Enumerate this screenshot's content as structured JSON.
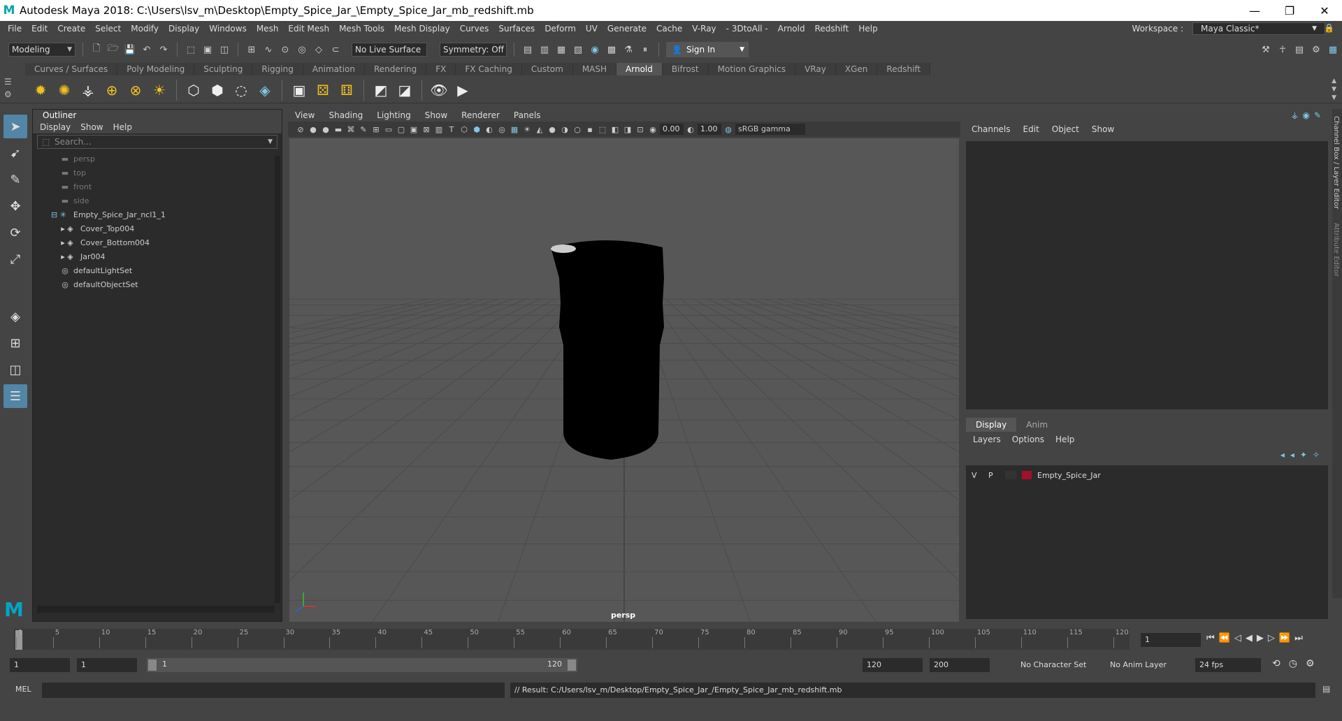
{
  "window": {
    "title": "Autodesk Maya 2018: C:\\Users\\lsv_m\\Desktop\\Empty_Spice_Jar_\\Empty_Spice_Jar_mb_redshift.mb"
  },
  "menus": [
    "File",
    "Edit",
    "Create",
    "Select",
    "Modify",
    "Display",
    "Windows",
    "Mesh",
    "Edit Mesh",
    "Mesh Tools",
    "Mesh Display",
    "Curves",
    "Surfaces",
    "Deform",
    "UV",
    "Generate",
    "Cache",
    "V-Ray",
    "- 3DtoAll -",
    "Arnold",
    "Redshift",
    "Help"
  ],
  "workspace": {
    "label": "Workspace :",
    "value": "Maya Classic*"
  },
  "status": {
    "mode": "Modeling",
    "live_surface": "No Live Surface",
    "symmetry": "Symmetry: Off",
    "sign_in": "Sign In"
  },
  "shelf_tabs": [
    "Curves / Surfaces",
    "Poly Modeling",
    "Sculpting",
    "Rigging",
    "Animation",
    "Rendering",
    "FX",
    "FX Caching",
    "Custom",
    "MASH",
    "Arnold",
    "Bifrost",
    "Motion Graphics",
    "VRay",
    "XGen",
    "Redshift"
  ],
  "active_shelf": "Arnold",
  "outliner": {
    "title": "Outliner",
    "menu": [
      "Display",
      "Show",
      "Help"
    ],
    "search_placeholder": "Search...",
    "cameras": [
      "persp",
      "top",
      "front",
      "side"
    ],
    "group": "Empty_Spice_Jar_ncl1_1",
    "children": [
      "Cover_Top004",
      "Cover_Bottom004",
      "Jar004"
    ],
    "sets": [
      "defaultLightSet",
      "defaultObjectSet"
    ]
  },
  "viewport": {
    "menu": [
      "View",
      "Shading",
      "Lighting",
      "Show",
      "Renderer",
      "Panels"
    ],
    "exposure": "0.00",
    "gamma": "1.00",
    "color_space": "sRGB gamma",
    "camera_label": "persp"
  },
  "channel_box": {
    "menu": [
      "Channels",
      "Edit",
      "Object",
      "Show"
    ],
    "side_label": "Channel Box / Layer Editor",
    "side_label2": "Attribute Editor"
  },
  "layer_editor": {
    "tabs": [
      "Display",
      "Anim"
    ],
    "menu": [
      "Layers",
      "Options",
      "Help"
    ],
    "layer": {
      "v": "V",
      "p": "P",
      "name": "Empty_Spice_Jar",
      "color": "#a3102a"
    }
  },
  "timeline": {
    "ticks": [
      "1",
      "5",
      "10",
      "15",
      "20",
      "25",
      "30",
      "35",
      "40",
      "45",
      "50",
      "55",
      "60",
      "65",
      "70",
      "75",
      "80",
      "85",
      "90",
      "95",
      "100",
      "105",
      "110",
      "115",
      "120"
    ],
    "current_frame": "1"
  },
  "range": {
    "start": "1",
    "playback_start": "1",
    "range_start": "1",
    "range_end": "120",
    "playback_end": "120",
    "end": "200",
    "character_set": "No Character Set",
    "anim_layer": "No Anim Layer",
    "fps": "24 fps"
  },
  "command": {
    "lang": "MEL",
    "result": "// Result: C:/Users/lsv_m/Desktop/Empty_Spice_Jar_/Empty_Spice_Jar_mb_redshift.mb"
  }
}
